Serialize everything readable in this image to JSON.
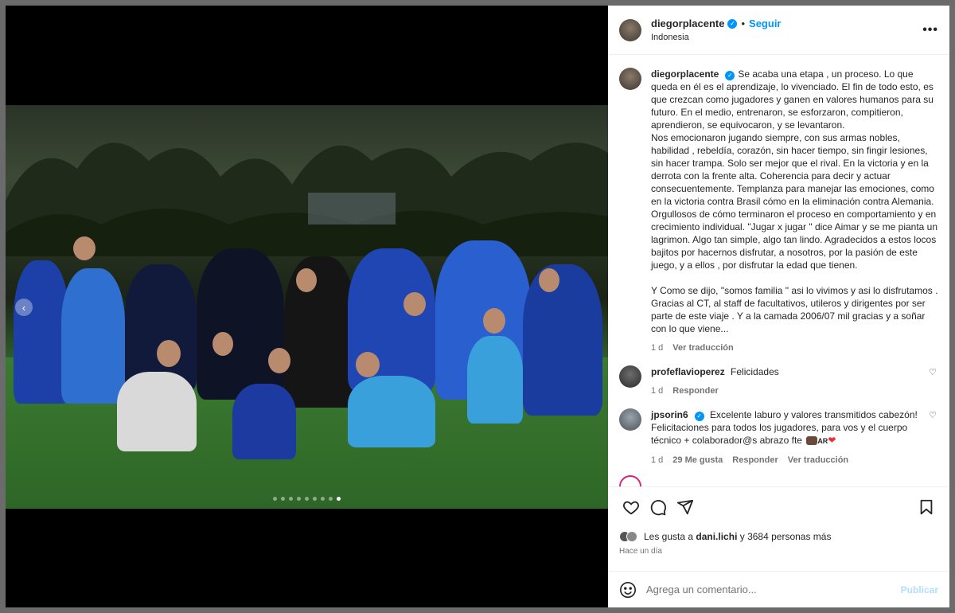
{
  "post": {
    "author": "diegorplacente",
    "location": "Indonesia",
    "follow_label": "Seguir",
    "separator": "•",
    "more_label": "•••",
    "caption": "Se acaba una etapa , un proceso. Lo que queda en él es el aprendizaje, lo vivenciado. El fin de todo esto, es que crezcan como jugadores y ganen en valores humanos para su futuro. En el medio, entrenaron, se esforzaron, compitieron, aprendieron, se equivocaron, y se levantaron.\nNos emocionaron jugando siempre, con sus armas nobles, habilidad , rebeldía, corazón, sin hacer tiempo, sin fingir lesiones, sin hacer trampa. Solo ser mejor que el rival. En la victoria y en la derrota con la frente alta. Coherencia para decir y actuar consecuentemente. Templanza para manejar las emociones, como en la victoria contra Brasil cómo en la eliminación contra Alemania. Orgullosos de cómo terminaron el proceso en comportamiento y en crecimiento individual. \"Jugar x jugar \" dice Aimar y se me pianta un lagrimon. Algo tan simple, algo tan lindo. Agradecidos a estos locos bajitos por hacernos disfrutar, a nosotros, por la pasión de este juego, y a ellos , por disfrutar la edad que tienen.\n\nY Como se dijo, \"somos familia \" asi lo vivimos y asi lo disfrutamos .\nGracias al CT, al staff de facultativos, utileros y dirigentes por ser parte de este viaje . Y a la camada 2006/07 mil gracias y a soñar con lo que viene...",
    "caption_time": "1 d",
    "see_translation": "Ver traducción",
    "carousel_prev": "‹"
  },
  "comments": [
    {
      "user": "profeflavioperez",
      "text": "Felicidades",
      "time": "1 d",
      "reply_label": "Responder"
    },
    {
      "user": "jpsorin6",
      "text": "Excelente laburo y valores transmitidos cabezón! Felicitaciones para todos los jugadores, para vos y el cuerpo técnico + colaborador@s abrazo fte",
      "flag_text": "AR",
      "heart": "❤",
      "time": "1 d",
      "likes": "29 Me gusta",
      "reply_label": "Responder",
      "see_translation": "Ver traducción"
    }
  ],
  "likes": {
    "prefix": "Les gusta a ",
    "user": "dani.lichi",
    "suffix": " y 3684 personas más"
  },
  "time_ago": "Hace un día",
  "add_comment": {
    "placeholder": "Agrega un comentario...",
    "publish_label": "Publicar"
  },
  "carousel": {
    "total": 9,
    "active_index": 8
  },
  "colors": {
    "accent": "#0095f6",
    "verified": "#0095f6",
    "heart": "#ed2d3a"
  }
}
